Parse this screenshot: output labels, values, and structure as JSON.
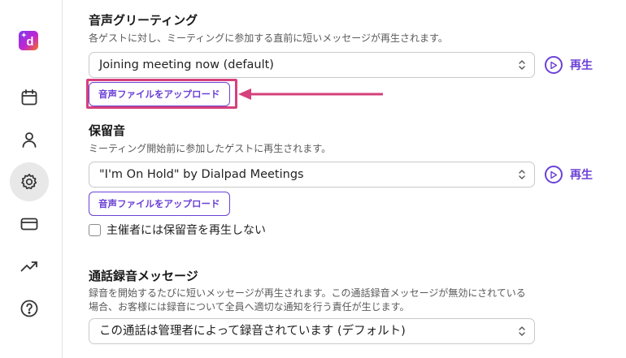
{
  "app": {
    "logo_letter": "d",
    "accent_color": "#6b41d6",
    "highlight_color": "#d6407c"
  },
  "sidebar": {
    "items": [
      {
        "name": "calendar",
        "icon": "calendar-icon"
      },
      {
        "name": "contacts",
        "icon": "person-icon"
      },
      {
        "name": "settings",
        "icon": "gear-icon",
        "active": true
      },
      {
        "name": "billing",
        "icon": "credit-card-icon"
      },
      {
        "name": "analytics",
        "icon": "trending-up-icon"
      },
      {
        "name": "help",
        "icon": "help-icon"
      }
    ]
  },
  "voice_greeting": {
    "title": "音声グリーティング",
    "description": "各ゲストに対し、ミーティングに参加する直前に短いメッセージが再生されます。",
    "selected": "Joining meeting now (default)",
    "play_label": "再生",
    "upload_label": "音声ファイルをアップロード"
  },
  "hold_music": {
    "title": "保留音",
    "description": "ミーティング開始前に参加したゲストに再生されます。",
    "selected": "\"I'm On Hold\" by Dialpad Meetings",
    "play_label": "再生",
    "upload_label": "音声ファイルをアップロード",
    "checkbox_label": "主催者には保留音を再生しない",
    "checkbox_checked": false
  },
  "recording_message": {
    "title": "通話録音メッセージ",
    "description_line1": "録音を開始するたびに短いメッセージが再生されます。この通話録音メッセージが無効にされている",
    "description_line2": "場合、お客様には録音について全員へ適切な通知を行う責任が生じます。",
    "selected": "この通話は管理者によって録音されています (デフォルト)"
  }
}
